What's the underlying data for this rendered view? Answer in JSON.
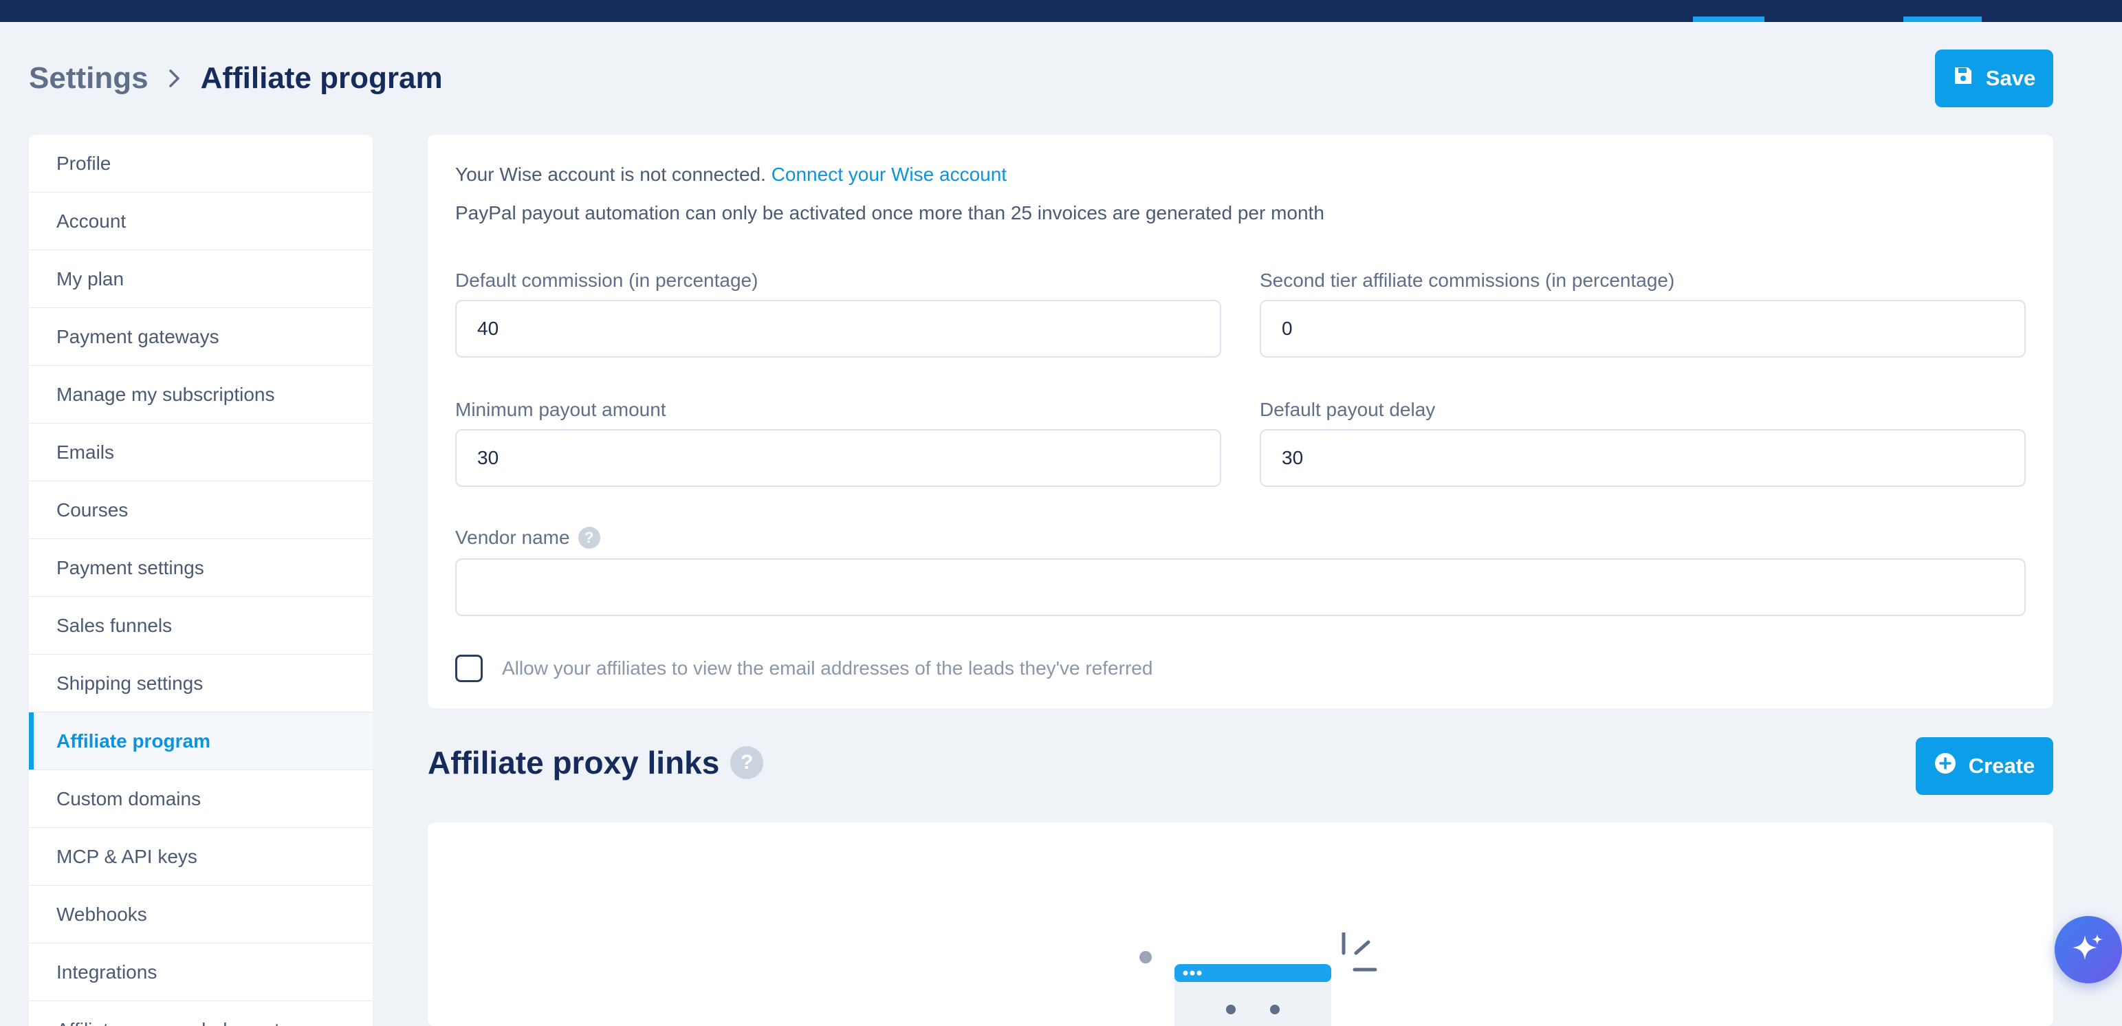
{
  "header": {
    "breadcrumb_parent": "Settings",
    "breadcrumb_current": "Affiliate program",
    "save_label": "Save"
  },
  "sidebar": {
    "items": [
      {
        "label": "Profile"
      },
      {
        "label": "Account"
      },
      {
        "label": "My plan"
      },
      {
        "label": "Payment gateways"
      },
      {
        "label": "Manage my subscriptions"
      },
      {
        "label": "Emails"
      },
      {
        "label": "Courses"
      },
      {
        "label": "Payment settings"
      },
      {
        "label": "Sales funnels"
      },
      {
        "label": "Shipping settings"
      },
      {
        "label": "Affiliate program",
        "active": true
      },
      {
        "label": "Custom domains"
      },
      {
        "label": "MCP & API keys"
      },
      {
        "label": "Webhooks"
      },
      {
        "label": "Integrations"
      },
      {
        "label": "Affiliate program help center"
      }
    ]
  },
  "settings": {
    "wise_status": "Your Wise account is not connected.",
    "wise_link": "Connect your Wise account",
    "paypal_note": "PayPal payout automation can only be activated once more than 25 invoices are generated per month",
    "default_commission_label": "Default commission (in percentage)",
    "default_commission_value": "40",
    "second_tier_label": "Second tier affiliate commissions (in percentage)",
    "second_tier_value": "0",
    "min_payout_label": "Minimum payout amount",
    "min_payout_value": "30",
    "payout_delay_label": "Default payout delay",
    "payout_delay_value": "30",
    "vendor_name_label": "Vendor name",
    "vendor_name_value": "",
    "help_glyph": "?",
    "allow_emails_label": "Allow your affiliates to view the email addresses of the leads they've referred",
    "allow_emails_checked": false
  },
  "proxy_links": {
    "title": "Affiliate proxy links",
    "create_label": "Create"
  },
  "colors": {
    "primary": "#0d9ee9",
    "navy": "#152b5c",
    "background": "#eff3f8"
  }
}
